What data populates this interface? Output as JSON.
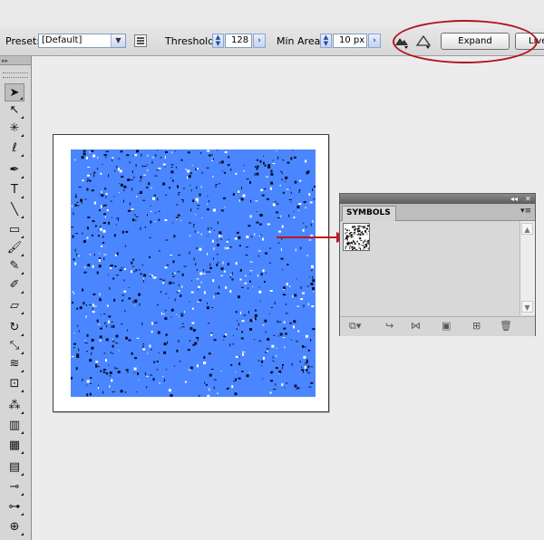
{
  "control_bar": {
    "preset_label": "Preset:",
    "preset_value": "[Default]",
    "threshold_label": "Threshold:",
    "threshold_value": "128",
    "min_area_label": "Min Area:",
    "min_area_value": "10 px",
    "expand_label": "Expand",
    "live_label": "Live"
  },
  "symbols_panel": {
    "tab_label": "SYMBOLS"
  },
  "colors": {
    "artwork_fill": "#4a86ff",
    "highlight_circle": "#b0151e",
    "arrow": "#c4151e"
  },
  "tools": [
    {
      "name": "selection-tool-icon",
      "glyph": "➤",
      "selected": true
    },
    {
      "name": "direct-selection-tool-icon",
      "glyph": "↖"
    },
    {
      "name": "magic-wand-tool-icon",
      "glyph": "✳"
    },
    {
      "name": "lasso-tool-icon",
      "glyph": "ℓ"
    },
    {
      "name": "pen-tool-icon",
      "glyph": "✒"
    },
    {
      "name": "type-tool-icon",
      "glyph": "T"
    },
    {
      "name": "line-tool-icon",
      "glyph": "╲"
    },
    {
      "name": "rectangle-tool-icon",
      "glyph": "▭"
    },
    {
      "name": "paintbrush-tool-icon",
      "glyph": "🖌"
    },
    {
      "name": "pencil-tool-icon",
      "glyph": "✎"
    },
    {
      "name": "blob-brush-tool-icon",
      "glyph": "✐"
    },
    {
      "name": "eraser-tool-icon",
      "glyph": "▱"
    },
    {
      "name": "rotate-tool-icon",
      "glyph": "↻"
    },
    {
      "name": "scale-tool-icon",
      "glyph": "⤡"
    },
    {
      "name": "warp-tool-icon",
      "glyph": "≋"
    },
    {
      "name": "free-transform-tool-icon",
      "glyph": "⊡"
    },
    {
      "name": "symbol-sprayer-tool-icon",
      "glyph": "⁂"
    },
    {
      "name": "column-graph-tool-icon",
      "glyph": "▥"
    },
    {
      "name": "mesh-tool-icon",
      "glyph": "▦"
    },
    {
      "name": "gradient-tool-icon",
      "glyph": "▤"
    },
    {
      "name": "eyedropper-tool-icon",
      "glyph": "⊸"
    },
    {
      "name": "blend-tool-icon",
      "glyph": "⊶"
    },
    {
      "name": "live-paint-bucket-tool-icon",
      "glyph": "⊕"
    }
  ]
}
